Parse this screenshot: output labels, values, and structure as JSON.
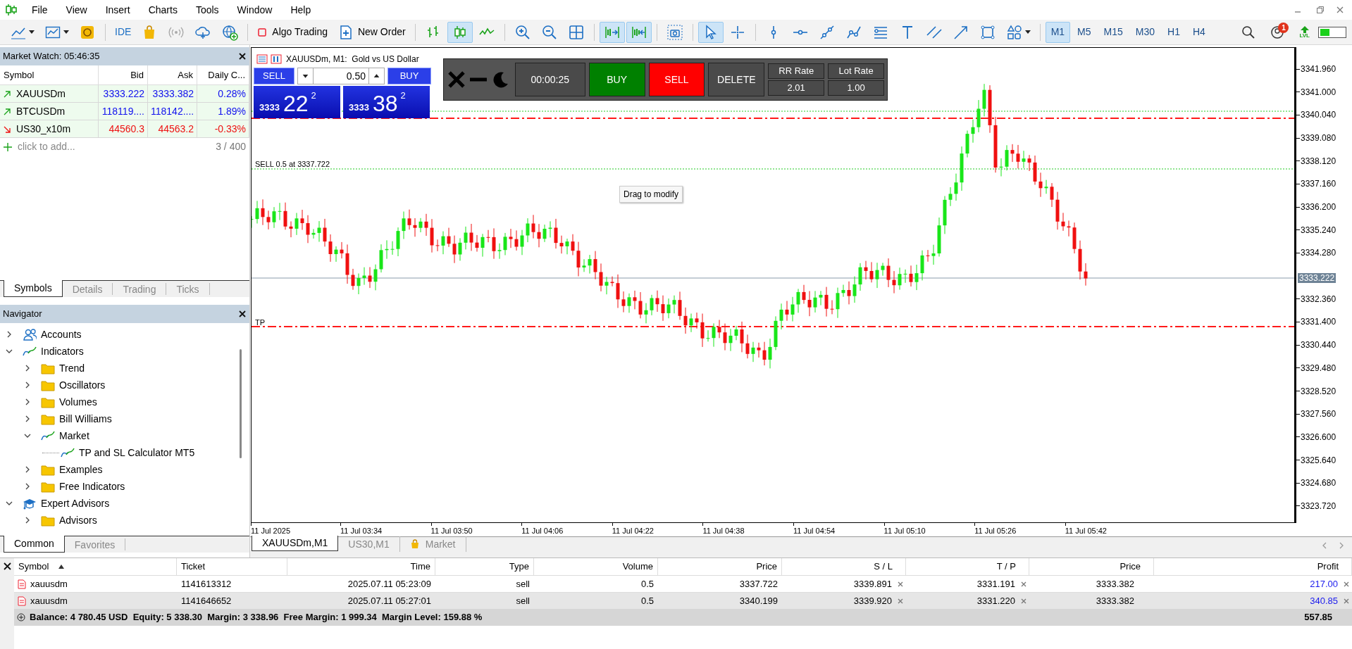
{
  "menu_bar": {
    "items": [
      "File",
      "View",
      "Insert",
      "Charts",
      "Tools",
      "Window",
      "Help"
    ]
  },
  "toolbar": {
    "ide_label": "IDE",
    "algo_trading": {
      "label": "Algo Trading",
      "on": false
    },
    "new_order": "New Order",
    "chart_types": [
      {
        "kind": "bars",
        "selected": false
      },
      {
        "kind": "candles",
        "selected": true
      },
      {
        "kind": "line",
        "selected": false
      }
    ],
    "auto_scroll": {
      "on": true
    },
    "chart_shift": {
      "on": true
    },
    "pointer_tools": [
      {
        "kind": "cursor",
        "selected": true
      },
      {
        "kind": "crosshair",
        "selected": false
      }
    ],
    "timeframes": [
      {
        "label": "M1",
        "selected": true
      },
      {
        "label": "M5",
        "selected": false
      },
      {
        "label": "M15",
        "selected": false
      },
      {
        "label": "M30",
        "selected": false
      },
      {
        "label": "H1",
        "selected": false
      },
      {
        "label": "H4",
        "selected": false
      }
    ],
    "notification_count": "1",
    "level_label": "LVL"
  },
  "market_watch": {
    "title": "Market Watch: 05:46:35",
    "columns": [
      "Symbol",
      "Bid",
      "Ask",
      "Daily C..."
    ],
    "rows": [
      {
        "symbol": "XAUUSDm",
        "rising": true,
        "bid": "3333.222",
        "ask": "3333.382",
        "change": "0.28%"
      },
      {
        "symbol": "BTCUSDm",
        "rising": true,
        "bid": "118119....",
        "ask": "118142....",
        "change": "1.89%"
      },
      {
        "symbol": "US30_x10m",
        "rising": false,
        "bid": "44560.3",
        "ask": "44563.2",
        "change": "-0.33%"
      }
    ],
    "add_row": {
      "placeholder": "click to add...",
      "count": "3 / 400"
    },
    "tabs": [
      {
        "label": "Symbols",
        "selected": true
      },
      {
        "label": "Details",
        "selected": false
      },
      {
        "label": "Trading",
        "selected": false
      },
      {
        "label": "Ticks",
        "selected": false
      }
    ]
  },
  "navigator": {
    "title": "Navigator",
    "tree": [
      {
        "label": "Accounts",
        "kind": "accounts",
        "expanded": false
      },
      {
        "label": "Indicators",
        "kind": "indicator",
        "expanded": true,
        "children": [
          {
            "label": "Trend",
            "kind": "folder",
            "expanded": false
          },
          {
            "label": "Oscillators",
            "kind": "folder",
            "expanded": false
          },
          {
            "label": "Volumes",
            "kind": "folder",
            "expanded": false
          },
          {
            "label": "Bill Williams",
            "kind": "folder",
            "expanded": false
          },
          {
            "label": "Market",
            "kind": "indicator",
            "expanded": true,
            "children": [
              {
                "label": "TP and SL Calculator MT5",
                "kind": "indicator"
              }
            ]
          },
          {
            "label": "Examples",
            "kind": "folder",
            "expanded": false
          },
          {
            "label": "Free Indicators",
            "kind": "folder",
            "expanded": false
          }
        ]
      },
      {
        "label": "Expert Advisors",
        "kind": "expert",
        "expanded": true,
        "children": [
          {
            "label": "Advisors",
            "kind": "folder",
            "expanded": false
          }
        ]
      }
    ],
    "tabs": [
      {
        "label": "Common",
        "selected": true
      },
      {
        "label": "Favorites",
        "selected": false
      }
    ]
  },
  "chart": {
    "header": "XAUUSDm, M1:  Gold vs US Dollar",
    "one_click": {
      "sell": "SELL",
      "buy": "BUY",
      "lot": "0.50",
      "bid": {
        "prefix": "3333",
        "main": "22",
        "sup": "2"
      },
      "ask": {
        "prefix": "3333",
        "main": "38",
        "sup": "2"
      }
    },
    "tool_panel": {
      "timer": "00:00:25",
      "buy": "BUY",
      "sell": "SELL",
      "delete": "DELETE",
      "rr_label": "RR Rate",
      "rr_value": "2.01",
      "lot_label": "Lot Rate",
      "lot_value": "1.00"
    },
    "order_label": "SELL 0.5 at 3337.722",
    "tp_label": "TP",
    "tooltip": "Drag to modify",
    "current_price": "3333.222",
    "price_ticks": [
      "3341.960",
      "3341.000",
      "3340.040",
      "3339.080",
      "3338.120",
      "3337.160",
      "3336.200",
      "3335.240",
      "3334.280",
      "3332.360",
      "3331.400",
      "3330.440",
      "3329.480",
      "3328.520",
      "3327.560",
      "3326.600",
      "3325.640",
      "3324.680",
      "3323.720"
    ],
    "time_ticks": [
      "11 Jul 2025",
      "11 Jul 03:34",
      "11 Jul 03:50",
      "11 Jul 04:06",
      "11 Jul 04:22",
      "11 Jul 04:38",
      "11 Jul 04:54",
      "11 Jul 05:10",
      "11 Jul 05:26",
      "11 Jul 05:42"
    ]
  },
  "chart_tabs": [
    {
      "label": "XAUUSDm,M1",
      "kind": "chart",
      "selected": true
    },
    {
      "label": "US30,M1",
      "kind": "chart",
      "selected": false
    },
    {
      "label": "Market",
      "kind": "market",
      "selected": false
    }
  ],
  "trades": {
    "columns": [
      "Symbol",
      "Ticket",
      "Time",
      "Type",
      "Volume",
      "Price",
      "S / L",
      "T / P",
      "Price",
      "Profit"
    ],
    "rows": [
      {
        "symbol": "xauusdm",
        "ticket": "1141613312",
        "time": "2025.07.11 05:23:09",
        "type": "sell",
        "volume": "0.5",
        "price": "3337.722",
        "sl": "3339.891",
        "tp": "3331.191",
        "current": "3333.382",
        "profit": "217.00",
        "selected": false
      },
      {
        "symbol": "xauusdm",
        "ticket": "1141646652",
        "time": "2025.07.11 05:27:01",
        "type": "sell",
        "volume": "0.5",
        "price": "3340.199",
        "sl": "3339.920",
        "tp": "3331.220",
        "current": "3333.382",
        "profit": "340.85",
        "selected": true
      }
    ],
    "summary": "Balance: 4 780.45 USD  Equity: 5 338.30  Margin: 3 338.96  Free Margin: 1 999.34  Margin Level: 159.88 %",
    "total": "557.85"
  }
}
